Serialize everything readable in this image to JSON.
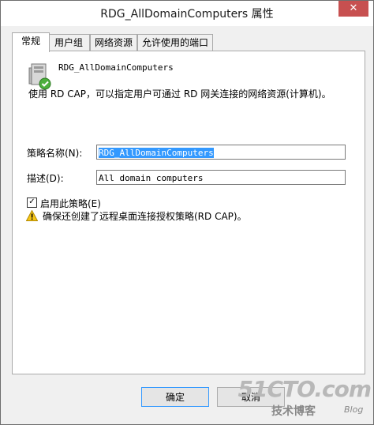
{
  "window": {
    "title": "RDG_AllDomainComputers 属性",
    "close_glyph": "✕"
  },
  "tabs": [
    {
      "label": "常规"
    },
    {
      "label": "用户组"
    },
    {
      "label": "网络资源"
    },
    {
      "label": "允许使用的端口"
    }
  ],
  "general": {
    "policy_display_name": "RDG_AllDomainComputers",
    "description_text": "使用 RD CAP，可以指定用户可通过 RD 网关连接的网络资源(计算机)。",
    "policy_name_label": "策略名称(N):",
    "policy_name_value": "RDG_AllDomainComputers",
    "description_label": "描述(D):",
    "description_value": "All domain computers",
    "enable_label": "启用此策略(E)",
    "enable_checked": true,
    "warning_text": "确保还创建了远程桌面连接授权策略(RD CAP)。"
  },
  "buttons": {
    "ok": "确定",
    "cancel": "取消"
  },
  "watermark": {
    "logo": "51CTO.com",
    "subtitle": "技术博客",
    "blog": "Blog"
  },
  "icons": {
    "policy": "server-policy-icon",
    "warning": "warning-icon",
    "check": "check-icon"
  },
  "colors": {
    "selection": "#3399ff",
    "close": "#c75050"
  }
}
